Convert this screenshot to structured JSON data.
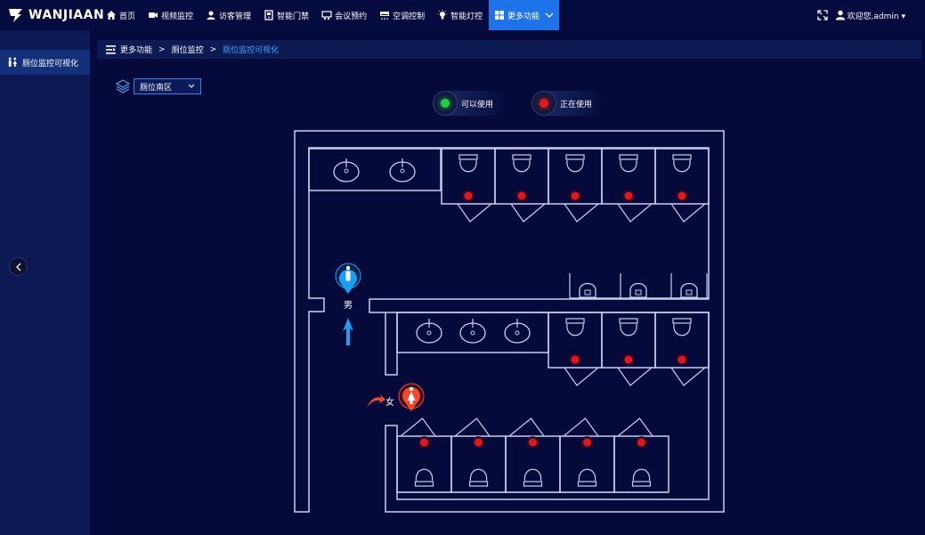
{
  "brand": {
    "name": "WANJIAAN"
  },
  "nav": {
    "items": [
      {
        "label": "首页",
        "icon": "home-icon"
      },
      {
        "label": "视频监控",
        "icon": "video-icon"
      },
      {
        "label": "访客管理",
        "icon": "visitor-icon"
      },
      {
        "label": "智能门禁",
        "icon": "door-icon"
      },
      {
        "label": "会议预约",
        "icon": "meeting-icon"
      },
      {
        "label": "空调控制",
        "icon": "ac-icon"
      },
      {
        "label": "智能灯控",
        "icon": "light-icon"
      }
    ],
    "more": {
      "label": "更多功能",
      "icon": "grid-icon"
    }
  },
  "user": {
    "greeting": "欢迎您,admin"
  },
  "sidebar": {
    "items": [
      {
        "label": "厕位监控可视化",
        "icon": "restroom-icon"
      }
    ]
  },
  "breadcrumb": {
    "items": [
      "更多功能",
      "厕位监控",
      "厕位监控可视化"
    ],
    "separator": ">"
  },
  "area_select": {
    "value": "厕位南区"
  },
  "legend": {
    "available": {
      "label": "可以使用",
      "color": "#22cc44"
    },
    "occupied": {
      "label": "正在使用",
      "color": "#e0181c"
    }
  },
  "floor": {
    "male_label": "男",
    "female_label": "女",
    "male_color": "#1aa0f0",
    "female_color": "#f04a2a",
    "wall_color": "#c8d0f0",
    "stalls": {
      "male_row_top": [
        "occupied",
        "occupied",
        "occupied",
        "occupied",
        "occupied"
      ],
      "male_row_mid": [
        "occupied",
        "occupied",
        "occupied"
      ],
      "female_row": [
        "occupied",
        "occupied",
        "occupied",
        "occupied",
        "occupied"
      ]
    },
    "urinal_count": 3,
    "sink_count_top": 2,
    "sink_count_mid": 3
  }
}
